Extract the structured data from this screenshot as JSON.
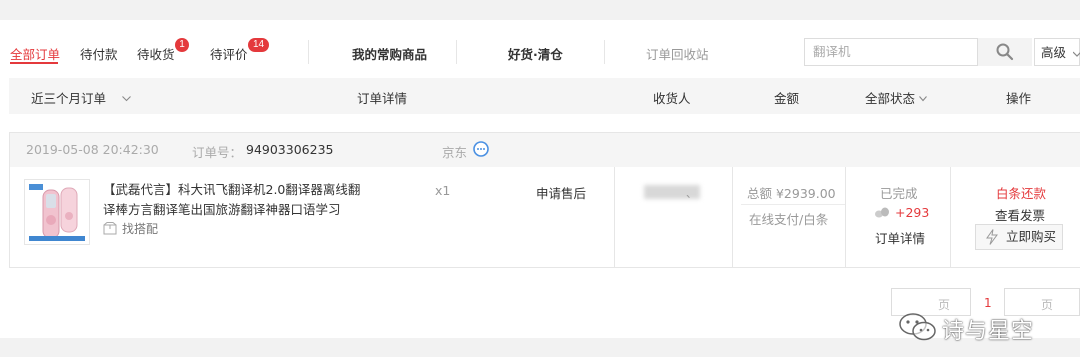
{
  "tabs": [
    {
      "label": "全部订单",
      "active": true
    },
    {
      "label": "待付款"
    },
    {
      "label": "待收货",
      "badge": "1"
    },
    {
      "label": "待评价",
      "badge": "14"
    },
    {
      "label": "我的常购商品"
    },
    {
      "label": "好货·清仓"
    },
    {
      "label": "订单回收站"
    }
  ],
  "search": {
    "placeholder": "翻译机",
    "advanced_label": "高级"
  },
  "table_header": {
    "period": "近三个月订单",
    "detail": "订单详情",
    "receiver": "收货人",
    "amount": "金额",
    "status": "全部状态",
    "actions": "操作"
  },
  "order": {
    "datetime": "2019-05-08 20:42:30",
    "order_no_label": "订单号：",
    "order_no": "94903306235",
    "shop": "京东",
    "product_name": "【武磊代言】科大讯飞翻译机2.0翻译器离线翻译棒方言翻译笔出国旅游翻译神器口语学习",
    "match_label": "找搭配",
    "quantity": "x1",
    "after_sale": "申请售后",
    "receiver_tail": "、",
    "total": "总额 ¥2939.00",
    "payment": "在线支付/白条",
    "status": "已完成",
    "jd_beans": "+293",
    "detail_link": "订单详情",
    "repay": "白条还款",
    "invoice": "查看发票",
    "buy_again": "立即购买"
  },
  "pagination": {
    "prev": "页",
    "current": "1",
    "next": "页"
  },
  "watermark": "诗与星空",
  "colors": {
    "accent": "#e4393c",
    "header_bg": "#f5f5f5"
  }
}
